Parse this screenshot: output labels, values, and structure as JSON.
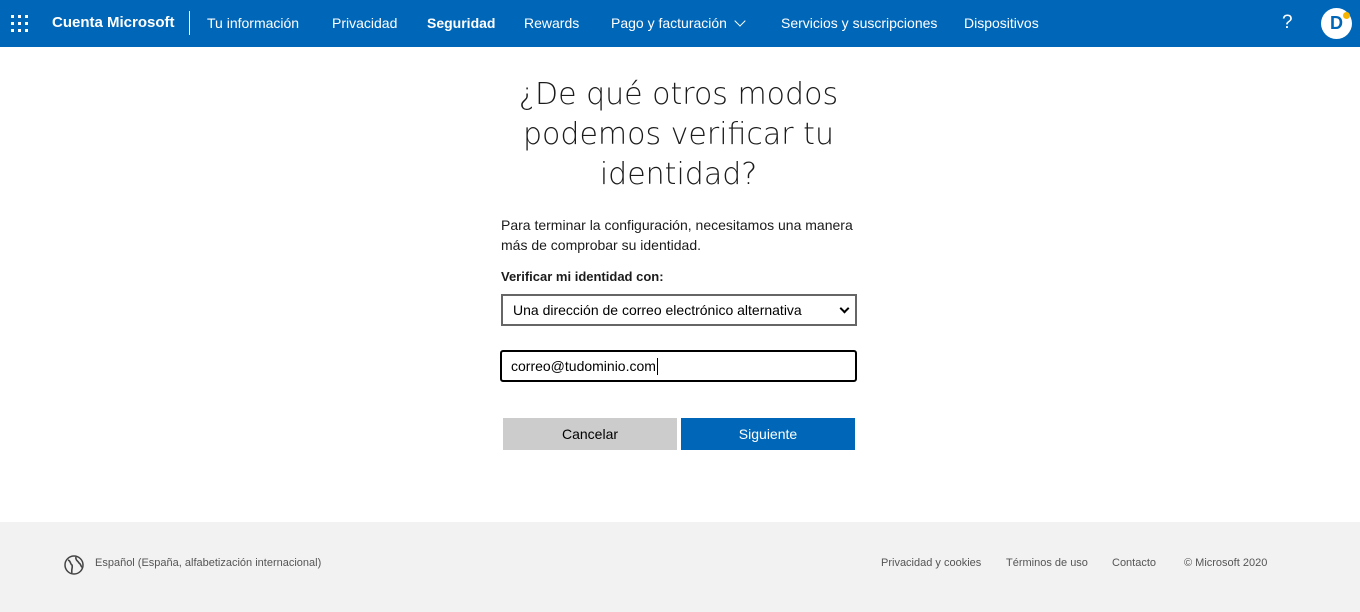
{
  "header": {
    "brand": "Cuenta Microsoft",
    "nav": [
      {
        "label": "Tu información",
        "active": false
      },
      {
        "label": "Privacidad",
        "active": false
      },
      {
        "label": "Seguridad",
        "active": true
      },
      {
        "label": "Rewards",
        "active": false
      },
      {
        "label": "Pago y facturación",
        "active": false
      },
      {
        "label": "Servicios y suscripciones",
        "active": false
      },
      {
        "label": "Dispositivos",
        "active": false
      }
    ],
    "help_label": "?",
    "avatar_initial": "D",
    "brand_color": "#0067b8"
  },
  "main": {
    "title": "¿De qué otros modos podemos verificar tu identidad?",
    "description": "Para terminar la configuración, necesitamos una manera más de comprobar su identidad.",
    "verify_label": "Verificar mi identidad con:",
    "method_selected": "Una dirección de correo electrónico alternativa",
    "email_value": "correo@tudominio.com",
    "cancel_label": "Cancelar",
    "next_label": "Siguiente"
  },
  "footer": {
    "locale": "Español (España, alfabetización internacional)",
    "links": [
      "Privacidad y cookies",
      "Términos de uso",
      "Contacto"
    ],
    "copyright": "© Microsoft 2020"
  }
}
